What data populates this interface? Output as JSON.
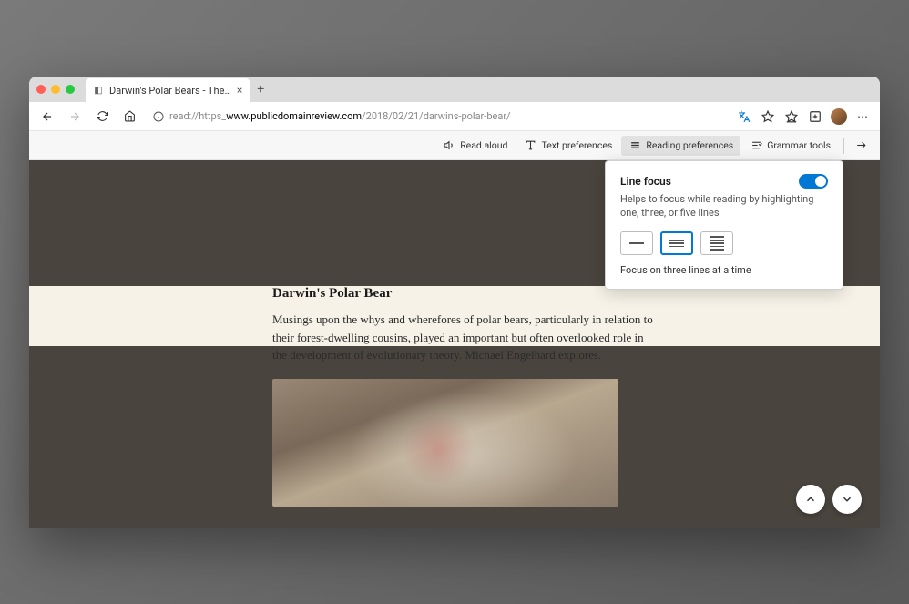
{
  "tab": {
    "title": "Darwin's Polar Bears - The…"
  },
  "url": {
    "protocol": "read://",
    "host_prefix": "https_",
    "host": "www.publicdomainreview.com",
    "path": "/2018/02/21/darwins-polar-bear/"
  },
  "toolbar": {
    "read_aloud": "Read aloud",
    "text_prefs": "Text preferences",
    "reading_prefs": "Reading preferences",
    "grammar": "Grammar tools"
  },
  "popup": {
    "title": "Line focus",
    "desc": "Helps to focus while reading by highlighting one, three, or five lines",
    "caption": "Focus on three lines at a time",
    "toggle_on": true,
    "selected": 1
  },
  "article": {
    "title": "Darwin's Polar Bear",
    "body": "Musings upon the whys and wherefores of polar bears, particularly in relation to their forest-dwelling cousins, played an important but often overlooked role in the development of evolutionary theory. Michael Engelhard explores."
  }
}
